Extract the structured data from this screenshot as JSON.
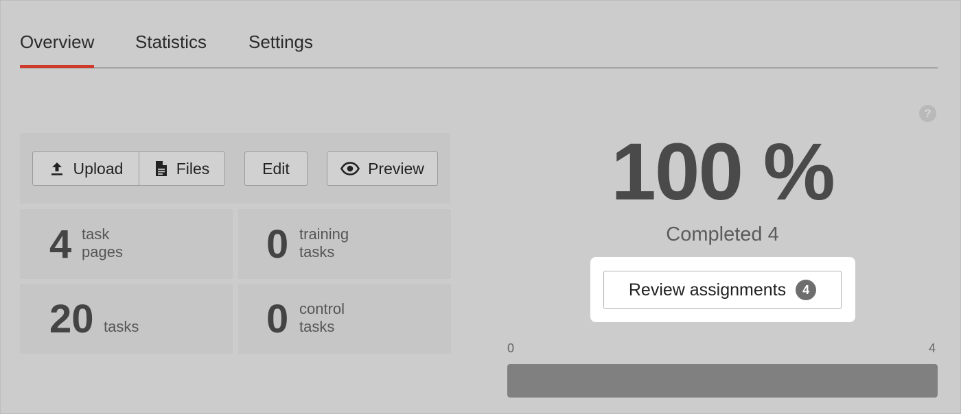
{
  "tabs": [
    {
      "label": "Overview",
      "active": true
    },
    {
      "label": "Statistics",
      "active": false
    },
    {
      "label": "Settings",
      "active": false
    }
  ],
  "toolbar": {
    "upload_label": "Upload",
    "upload_icon": "upload-icon",
    "files_label": "Files",
    "files_icon": "file-icon",
    "edit_label": "Edit",
    "preview_label": "Preview",
    "preview_icon": "eye-icon"
  },
  "stats": [
    {
      "value": "4",
      "label": "task\npages"
    },
    {
      "value": "0",
      "label": "training\ntasks"
    },
    {
      "value": "20",
      "label": "tasks"
    },
    {
      "value": "0",
      "label": "control\ntasks"
    }
  ],
  "summary": {
    "help_icon": "question-icon",
    "help_glyph": "?",
    "percent": "100 %",
    "completed_label": "Completed 4",
    "review_label": "Review assignments",
    "review_count": "4"
  },
  "progress": {
    "min_label": "0",
    "max_label": "4",
    "fraction": 1.0
  },
  "colors": {
    "background": "#cccccc",
    "tab_active_underline": "#cf3a2b",
    "progress_fill": "#808080",
    "badge": "#6e6e6e"
  }
}
